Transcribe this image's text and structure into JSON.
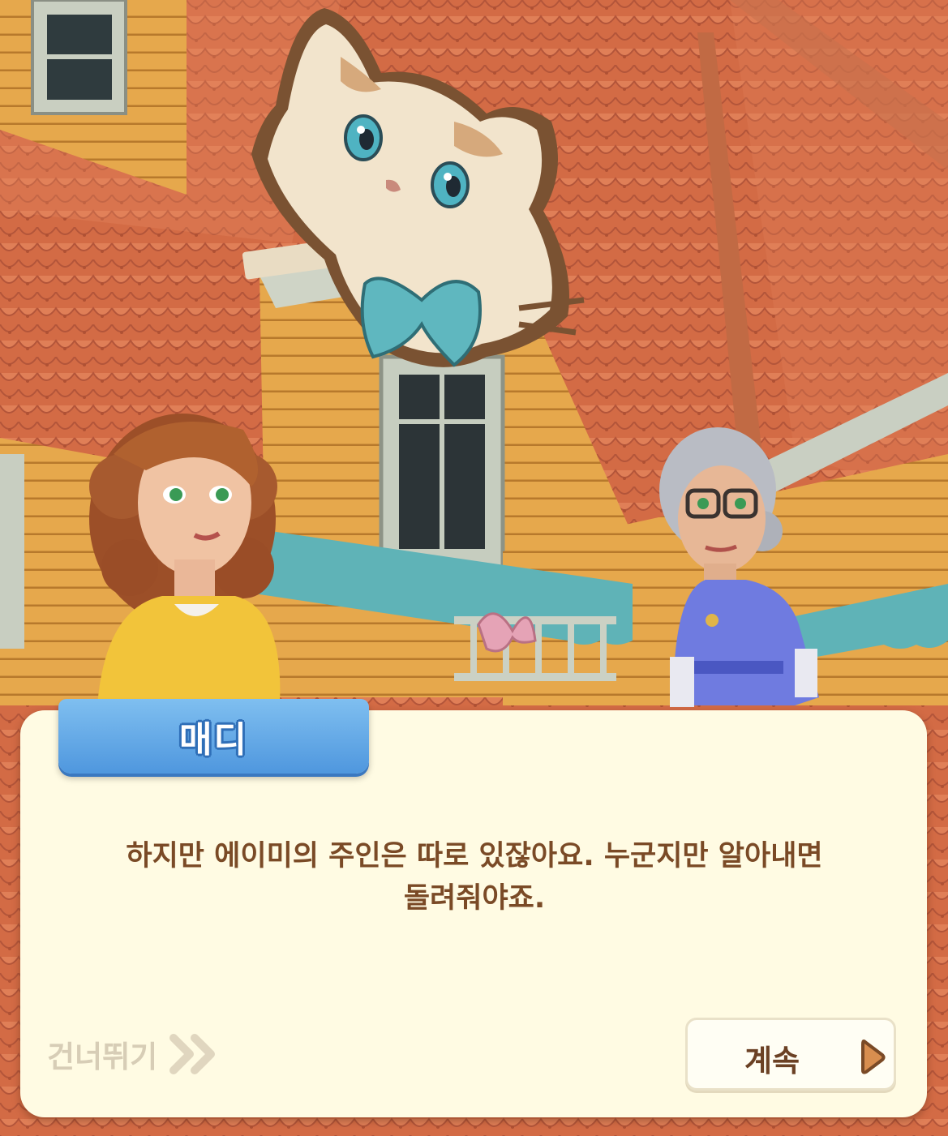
{
  "scene": {
    "background": "cozy house exterior with orange shingled roof and cat-shaped wooden sign with teal bow",
    "characters": [
      {
        "name_icon": "young-woman-avatar"
      },
      {
        "name_icon": "elderly-woman-avatar"
      }
    ]
  },
  "dialog": {
    "speaker": "매디",
    "text": "하지만 에이미의 주인은 따로 있잖아요. 누군지만 알아내면\n돌려줘야죠."
  },
  "controls": {
    "skip_label": "건너뛰기",
    "skip_icon": "double-chevron-right-icon",
    "continue_label": "계속",
    "continue_icon": "triangle-right-icon"
  },
  "colors": {
    "roof": "#d9744a",
    "wall": "#e3a54a",
    "dialog_bg": "#fffbe3",
    "name_tag": "#5aa3e6",
    "text": "#7a4a26",
    "skip_text": "#d7cdb6"
  }
}
